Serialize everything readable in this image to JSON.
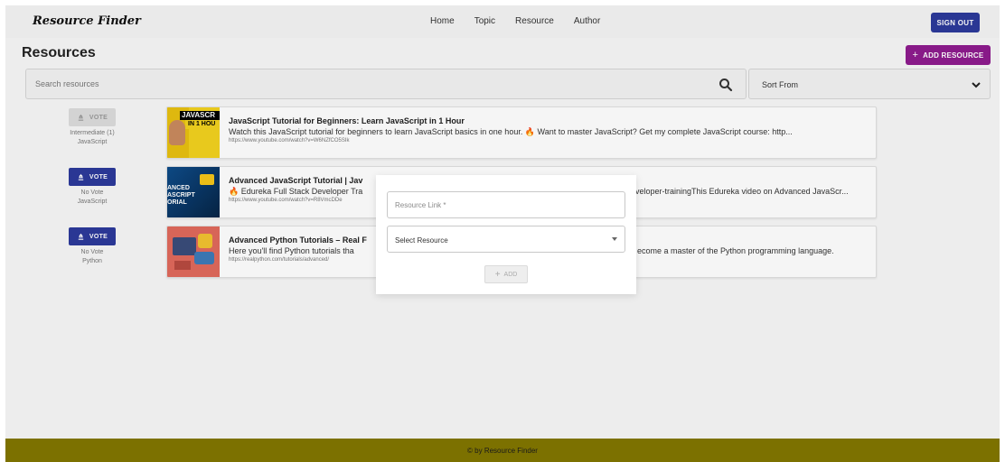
{
  "header": {
    "brand": "Resource Finder",
    "nav": [
      "Home",
      "Topic",
      "Resource",
      "Author"
    ],
    "signout_label": "SIGN OUT"
  },
  "page": {
    "title": "Resources",
    "add_resource_label": "ADD RESOURCE"
  },
  "search": {
    "placeholder": "Search resources"
  },
  "sort": {
    "label": "Sort From"
  },
  "vote_label": "VOTE",
  "resources": [
    {
      "vote_state": "disabled",
      "vote_count": "Intermediate (1)",
      "topic": "JavaScript",
      "title": "JavaScript Tutorial for Beginners: Learn JavaScript in 1 Hour",
      "description": "Watch this JavaScript tutorial for beginners to learn JavaScript basics in one hour. 🔥 Want to master JavaScript? Get my complete JavaScript course: http...",
      "url": "https://www.youtube.com/watch?v=W6NZfCO5SIk",
      "thumb_text": [
        "JAVASCR",
        "IN 1 HOU"
      ]
    },
    {
      "vote_state": "active",
      "vote_count": "No Vote",
      "topic": "JavaScript",
      "title": "Advanced JavaScript Tutorial | Jav",
      "description": "🔥 Edureka Full Stack Developer Tra",
      "description_tail": "veloper-trainingThis Edureka video on Advanced JavaScr...",
      "url": "https://www.youtube.com/watch?v=R8VmcDDe",
      "thumb_text": [
        "ANCED",
        "ASCRIPT",
        "ORIAL"
      ]
    },
    {
      "vote_state": "active",
      "vote_count": "No Vote",
      "topic": "Python",
      "title": "Advanced Python Tutorials – Real F",
      "description": "Here you'll find Python tutorials tha",
      "description_tail": "ecome a master of the Python programming language.",
      "url": "https://realpython.com/tutorials/advanced/",
      "thumb_text": []
    }
  ],
  "modal": {
    "link_placeholder": "Resource Link *",
    "select_label": "Select Resource",
    "add_label": "ADD"
  },
  "footer": {
    "text": "© by Resource Finder"
  },
  "colors": {
    "primary": "#2c3a9b",
    "accent": "#8e1c8e",
    "footer": "#7c7100"
  }
}
